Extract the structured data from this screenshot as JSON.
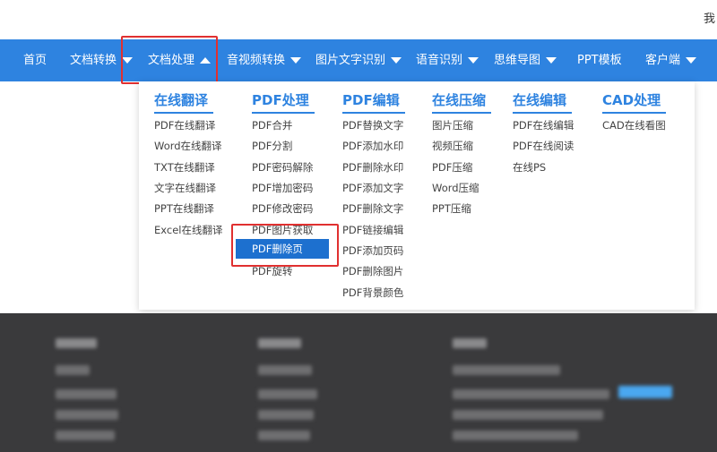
{
  "topbar": {
    "corner_text": "我"
  },
  "nav": {
    "items": [
      {
        "label": "首页",
        "caret": ""
      },
      {
        "label": "文档转换",
        "caret": "down"
      },
      {
        "label": "文档处理",
        "caret": "up"
      },
      {
        "label": "音视频转换",
        "caret": "down"
      },
      {
        "label": "图片文字识别",
        "caret": "down"
      },
      {
        "label": "语音识别",
        "caret": "down"
      },
      {
        "label": "思维导图",
        "caret": "down"
      },
      {
        "label": "PPT模板",
        "caret": ""
      },
      {
        "label": "客户端",
        "caret": "down"
      }
    ],
    "active_index": 2
  },
  "dropdown": {
    "columns": [
      {
        "title": "在线翻译",
        "items": [
          "PDF在线翻译",
          "Word在线翻译",
          "TXT在线翻译",
          "文字在线翻译",
          "PPT在线翻译",
          "Excel在线翻译"
        ]
      },
      {
        "title": "PDF处理",
        "items": [
          "PDF合并",
          "PDF分割",
          "PDF密码解除",
          "PDF增加密码",
          "PDF修改密码",
          "PDF图片获取",
          "PDF删除页",
          "PDF旋转"
        ]
      },
      {
        "title": "PDF编辑",
        "items": [
          "PDF替换文字",
          "PDF添加水印",
          "PDF删除水印",
          "PDF添加文字",
          "PDF删除文字",
          "PDF链接编辑",
          "PDF添加页码",
          "PDF删除图片",
          "PDF背景颜色"
        ]
      },
      {
        "title": "在线压缩",
        "items": [
          "图片压缩",
          "视频压缩",
          "PDF压缩",
          "Word压缩",
          "PPT压缩"
        ]
      },
      {
        "title": "在线编辑",
        "items": [
          "PDF在线编辑",
          "PDF在线阅读",
          "在线PS"
        ]
      },
      {
        "title": "CAD处理",
        "items": [
          "CAD在线看图"
        ]
      }
    ],
    "selected_item": "PDF删除页"
  },
  "colors": {
    "nav_bg": "#2e83e0",
    "accent": "#2e83e0",
    "selected_bg": "#1d70cf",
    "highlight_border": "#e03030",
    "footer_bg": "#3a3a3c"
  }
}
